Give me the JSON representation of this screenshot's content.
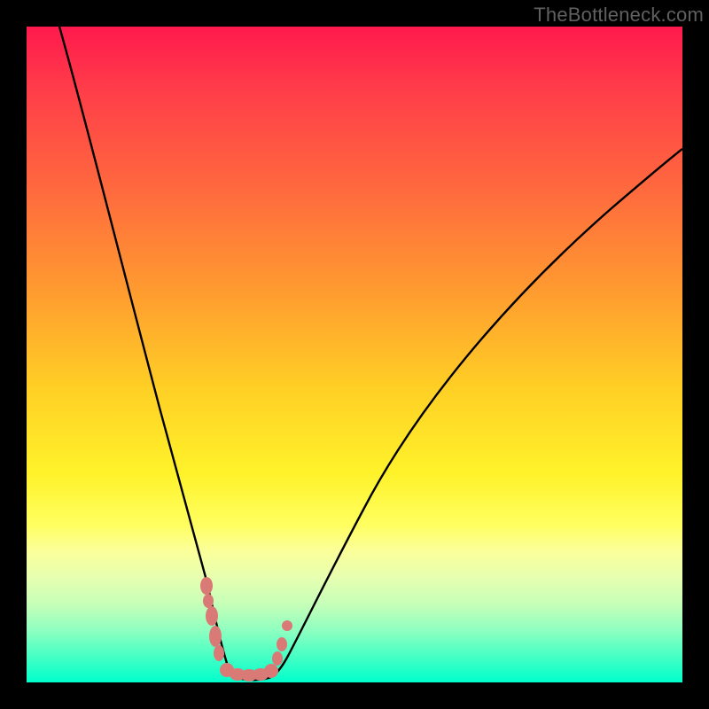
{
  "watermark": "TheBottleneck.com",
  "colors": {
    "frame": "#000000",
    "gradient_top": "#ff1a4d",
    "gradient_bottom": "#00ffcc",
    "curve": "#000000",
    "marker": "#d97a77"
  },
  "chart_data": {
    "type": "line",
    "title": "",
    "xlabel": "",
    "ylabel": "",
    "xlim": [
      0,
      100
    ],
    "ylim": [
      0,
      100
    ],
    "grid": false,
    "legend": false,
    "background": "rainbow-vertical-gradient",
    "series": [
      {
        "name": "bottleneck-curve",
        "x_percent": [
          5,
          7,
          10,
          13,
          16,
          19,
          22,
          24,
          26,
          28,
          29,
          30,
          31,
          33,
          35,
          37,
          40,
          44,
          50,
          58,
          68,
          80,
          92,
          100
        ],
        "y_percent": [
          100,
          93,
          84,
          74,
          64,
          54,
          43,
          34,
          25,
          15,
          9,
          4,
          0,
          0,
          0,
          0,
          2,
          7,
          15,
          26,
          39,
          52,
          63,
          70
        ],
        "note": "y is distance from bottom of plot as percent of plot height; curve follows left and right arms meeting at a flat minimum around x≈31–37%"
      }
    ],
    "markers": [
      {
        "name": "left-cluster-upper",
        "approx_xy_percent": [
          27.5,
          12
        ],
        "shape": "vertical-blob"
      },
      {
        "name": "left-cluster-lower",
        "approx_xy_percent": [
          28.5,
          5
        ],
        "shape": "vertical-blob"
      },
      {
        "name": "bottom-run",
        "approx_xy_percent": [
          33,
          1.5
        ],
        "shape": "horizontal-lumpy-bar",
        "extent_x_percent": [
          30,
          38
        ]
      },
      {
        "name": "right-cluster-dot",
        "approx_xy_percent": [
          39,
          10
        ],
        "shape": "dot"
      },
      {
        "name": "right-cluster-small",
        "approx_xy_percent": [
          38.5,
          6
        ],
        "shape": "small-blob"
      }
    ]
  }
}
